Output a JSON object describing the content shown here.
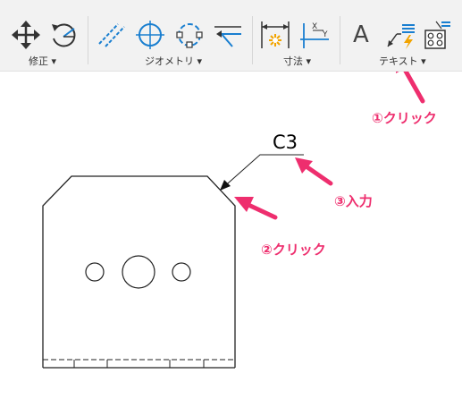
{
  "toolbar": {
    "groups": [
      {
        "label": "修正"
      },
      {
        "label": "ジオメトリ"
      },
      {
        "label": "寸法"
      },
      {
        "label": "テキスト"
      }
    ],
    "icons": [
      "move-icon",
      "rotate-icon",
      "parallel-lines-icon",
      "circle-center-icon",
      "circle-three-point-icon",
      "extend-lines-icon",
      "linear-dimension-icon",
      "ordinate-dimension-icon",
      "text-icon",
      "leader-note-icon",
      "hole-table-icon"
    ],
    "text_icon_glyph": "A",
    "accent_color": "#1a7fd0"
  },
  "drawing": {
    "chamfer_note": "C3"
  },
  "annotations": {
    "step1": "①クリック",
    "step2": "②クリック",
    "step3": "③入力",
    "color": "#ee2e6e"
  }
}
